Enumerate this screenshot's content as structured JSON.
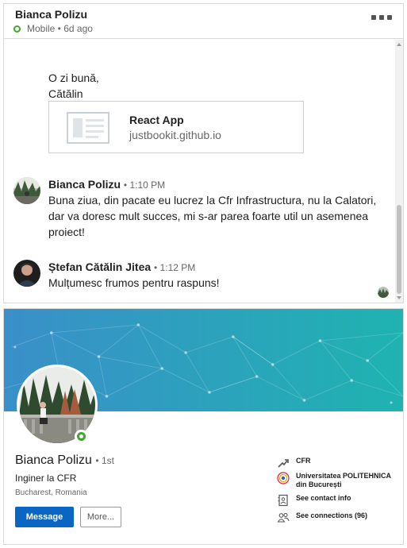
{
  "chat": {
    "contact_name": "Bianca Polizu",
    "presence": "Mobile • 6d ago",
    "greeting_line1": "O zi bună,",
    "greeting_line2": "Cătălin",
    "link_preview": {
      "title": "React App",
      "url": "justbookit.github.io"
    },
    "messages": [
      {
        "author": "Bianca Polizu",
        "time": "• 1:10 PM",
        "text": "Buna ziua, din pacate eu lucrez la Cfr Infrastructura, nu la Calatori, dar va doresc mult succes, mi s-ar parea foarte util un asemenea proiect!"
      },
      {
        "author": "Ștefan Cătălin Jitea",
        "time": "• 1:12 PM",
        "text": "Mulțumesc frumos pentru raspuns!"
      }
    ]
  },
  "profile": {
    "name": "Bianca Polizu",
    "degree": "• 1st",
    "headline": "Inginer la CFR",
    "location": "Bucharest, Romania",
    "message_button": "Message",
    "more_button": "More...",
    "company": "CFR",
    "school": "Universitatea POLITEHNICA din București",
    "contact_info": "See contact info",
    "connections": "See connections (96)"
  },
  "colors": {
    "accent": "#0a66c2",
    "online": "#45a431",
    "cover_gradient": [
      "#3a8fc9",
      "#1fb3b1"
    ]
  }
}
